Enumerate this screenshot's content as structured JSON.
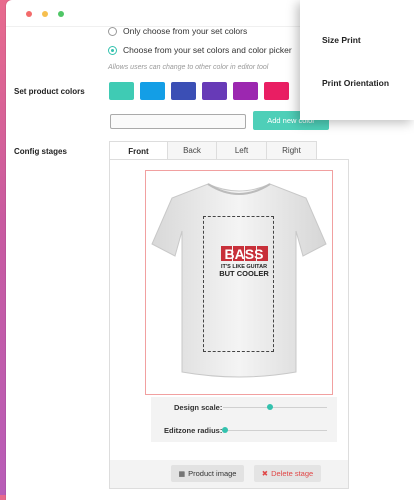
{
  "window": {
    "dots": [
      "close",
      "minimize",
      "maximize"
    ]
  },
  "color_mode": {
    "options": [
      {
        "label": "Only choose from your set colors",
        "selected": false
      },
      {
        "label": "Choose from your set colors and color picker",
        "selected": true
      }
    ],
    "hint": "Allows users can change to other color in editor tool"
  },
  "product_colors": {
    "label": "Set product colors",
    "swatches": [
      "#3fcbb4",
      "#139ee6",
      "#3b4fb5",
      "#673ab7",
      "#9c27b0",
      "#e91e63"
    ],
    "input_value": "",
    "add_button": "Add new color"
  },
  "config": {
    "label": "Config stages",
    "tabs": [
      "Front",
      "Back",
      "Left",
      "Right"
    ],
    "active_tab": "Front"
  },
  "preview": {
    "shirt_text": [
      "BASS",
      "IT'S LIKE GUITAR",
      "BUT COOLER"
    ]
  },
  "sliders": {
    "design_scale": {
      "label": "Design scale:",
      "value": 0.45
    },
    "editzone_radius": {
      "label": "Editzone radius:",
      "value": 0.02
    }
  },
  "actions": {
    "product_image": "Product image",
    "delete_stage": "Delete stage"
  },
  "popover": {
    "items": [
      "Size Print",
      "Print Orientation"
    ]
  }
}
